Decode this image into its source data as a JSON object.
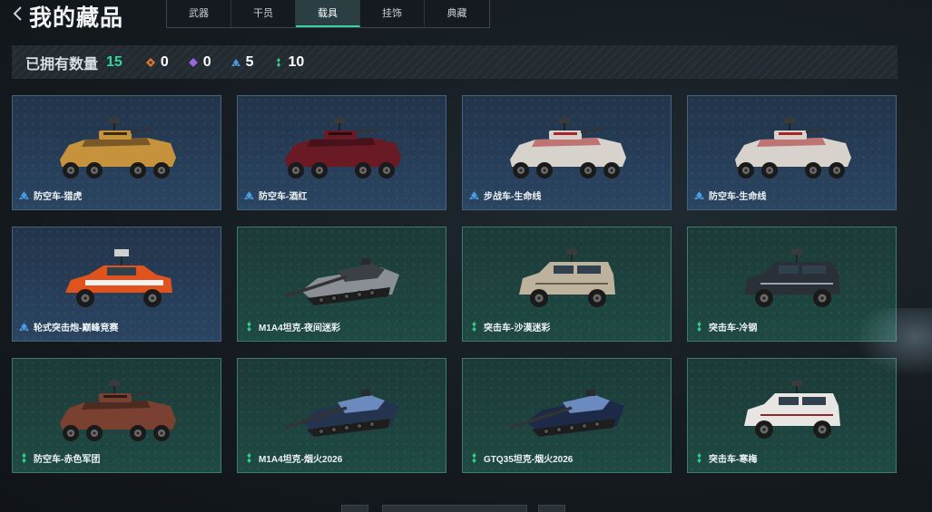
{
  "header": {
    "title": "我的藏品",
    "tabs": [
      {
        "label": "武器",
        "active": false
      },
      {
        "label": "干员",
        "active": false
      },
      {
        "label": "载具",
        "active": true
      },
      {
        "label": "挂饰",
        "active": false
      },
      {
        "label": "典藏",
        "active": false
      }
    ]
  },
  "stats": {
    "owned_label": "已拥有数量",
    "owned_count": "15",
    "counts": [
      {
        "icon": "orange-diamond-icon",
        "color": "#e0773a",
        "value": "0"
      },
      {
        "icon": "purple-diamond-icon",
        "color": "#9a64e0",
        "value": "0"
      },
      {
        "icon": "blue-diamond-icon",
        "color": "#4a9ae0",
        "value": "5"
      },
      {
        "icon": "green-diamond-icon",
        "color": "#2fcf8c",
        "value": "10"
      }
    ]
  },
  "colors": {
    "accent": "#32d59a",
    "blue_rarity": "#4a9ae0",
    "green_rarity": "#2fcf8c"
  },
  "items": [
    {
      "name": "防空车-猎虎",
      "rarity": "blue",
      "vehicle": "wheeled-8x8",
      "paint": "#c7923c",
      "accent": "#3a2a18"
    },
    {
      "name": "防空车-酒红",
      "rarity": "blue",
      "vehicle": "wheeled-8x8",
      "paint": "#6a1a24",
      "accent": "#2a0c10"
    },
    {
      "name": "步战车-生命线",
      "rarity": "blue",
      "vehicle": "wheeled-8x8",
      "paint": "#d8d2cc",
      "accent": "#a8262a"
    },
    {
      "name": "防空车-生命线",
      "rarity": "blue",
      "vehicle": "wheeled-8x8",
      "paint": "#d8d2cc",
      "accent": "#a8262a"
    },
    {
      "name": "轮式突击炮-巅峰竞赛",
      "rarity": "blue",
      "vehicle": "buggy",
      "paint": "#e2521c",
      "accent": "#f2f2f2"
    },
    {
      "name": "M1A4坦克-夜间迷彩",
      "rarity": "green",
      "vehicle": "tank",
      "paint": "#8a8f95",
      "accent": "#3c4045"
    },
    {
      "name": "突击车-沙漠迷彩",
      "rarity": "green",
      "vehicle": "mrap",
      "paint": "#bdb29c",
      "accent": "#6a5f4a"
    },
    {
      "name": "突击车-冷钢",
      "rarity": "green",
      "vehicle": "mrap",
      "paint": "#2a3038",
      "accent": "#9aa4b0"
    },
    {
      "name": "防空车-赤色军团",
      "rarity": "green",
      "vehicle": "wheeled-8x8",
      "paint": "#7a4030",
      "accent": "#2a1a14"
    },
    {
      "name": "M1A4坦克-烟火2026",
      "rarity": "green",
      "vehicle": "tank",
      "paint": "#24344e",
      "accent": "#6a8ac0"
    },
    {
      "name": "GTQ35坦克-烟火2026",
      "rarity": "green",
      "vehicle": "tank",
      "paint": "#1c2a48",
      "accent": "#6a8ac0"
    },
    {
      "name": "突击车-寒梅",
      "rarity": "green",
      "vehicle": "mrap",
      "paint": "#e8e6e2",
      "accent": "#8a2a2a"
    }
  ]
}
